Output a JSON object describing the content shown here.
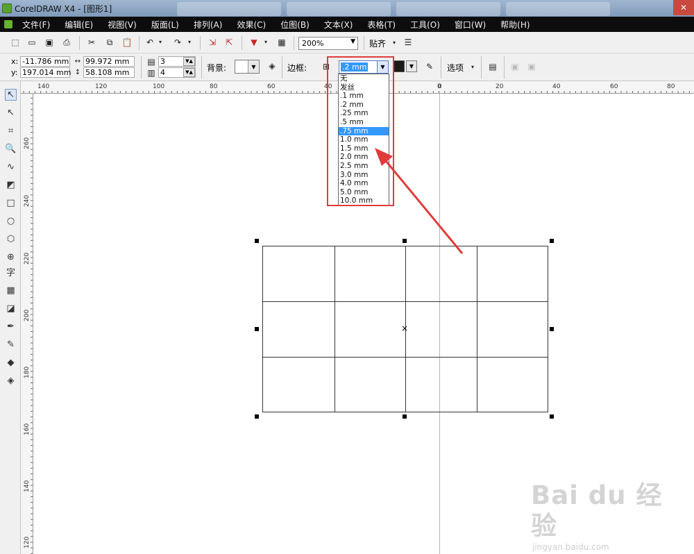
{
  "window": {
    "title": "CorelDRAW X4 - [图形1]"
  },
  "menu": [
    "文件(F)",
    "编辑(E)",
    "视图(V)",
    "版面(L)",
    "排列(A)",
    "效果(C)",
    "位图(B)",
    "文本(X)",
    "表格(T)",
    "工具(O)",
    "窗口(W)",
    "帮助(H)"
  ],
  "toolbar": {
    "zoom": "200%",
    "snap": "贴齐"
  },
  "propbar": {
    "x_label": "x:",
    "x": "-11.786 mm",
    "y_label": "y:",
    "y": "197.014 mm",
    "w": "99.972 mm",
    "h": "58.108 mm",
    "rows": "3",
    "cols": "4",
    "background_label": "背景:",
    "outline_label": "边框:",
    "outline_value": ".2 mm",
    "options_label": "选项"
  },
  "outline_dropdown": {
    "options": [
      "无",
      "发丝",
      ".1 mm",
      ".2 mm",
      ".25 mm",
      ".5 mm",
      ".75 mm",
      "1.0 mm",
      "1.5 mm",
      "2.0 mm",
      "2.5 mm",
      "3.0 mm",
      "4.0 mm",
      "5.0 mm",
      "10.0 mm"
    ],
    "selected": ".75 mm"
  },
  "ruler": {
    "h_labels": [
      "140",
      "120",
      "100",
      "80",
      "60",
      "40",
      "20",
      "0",
      "20",
      "40",
      "60",
      "80"
    ],
    "v_labels": [
      "260",
      "240",
      "220",
      "200",
      "180",
      "160",
      "140",
      "120"
    ]
  },
  "table": {
    "rows": 3,
    "cols": 4
  },
  "watermark": {
    "brand": "Bai du 经验",
    "url": "jingyan.baidu.com"
  },
  "colors": {
    "annotation": "#e03b3b",
    "selection": "#3399ff",
    "menubar": "#0d0d0d"
  }
}
